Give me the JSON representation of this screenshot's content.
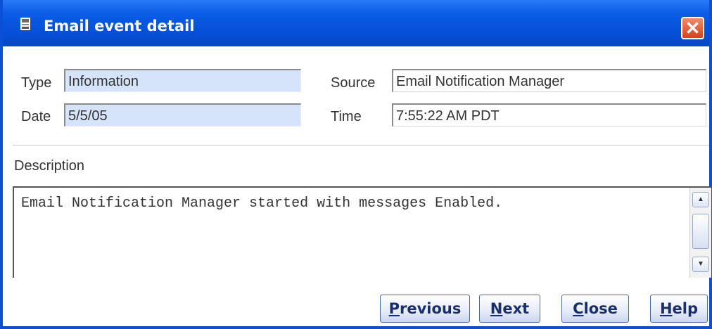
{
  "window": {
    "title": "Email event detail",
    "close_glyph": "✕",
    "accent_color": "#0550d8"
  },
  "fields": {
    "type_label": "Type",
    "type_value": "Information",
    "date_label": "Date",
    "date_value": "5/5/05",
    "source_label": "Source",
    "source_value": "Email Notification Manager",
    "time_label": "Time",
    "time_value": "7:55:22 AM PDT"
  },
  "description": {
    "label": "Description",
    "text": "Email Notification Manager started with messages Enabled."
  },
  "scrollbar": {
    "up_glyph": "▲",
    "down_glyph": "▼"
  },
  "buttons": {
    "previous": "Previous",
    "next": "Next",
    "close": "Close",
    "help": "Help"
  }
}
